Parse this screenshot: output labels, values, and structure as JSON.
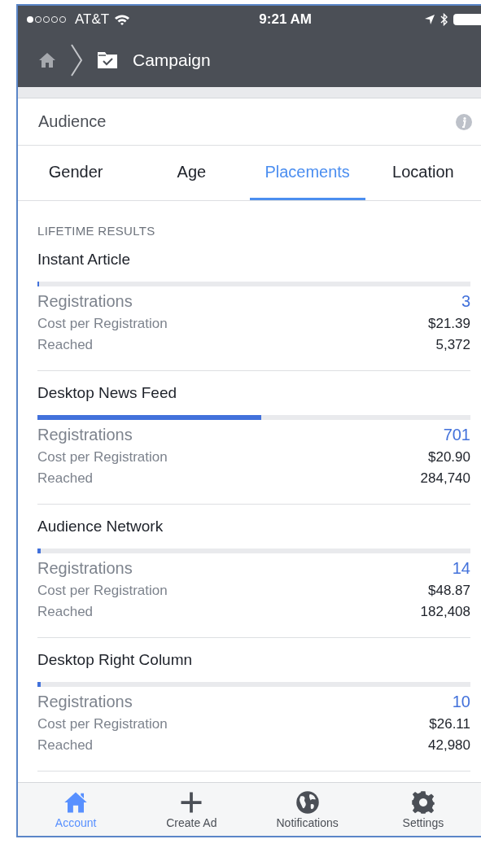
{
  "status_bar": {
    "carrier": "AT&T",
    "time": "9:21 AM"
  },
  "nav": {
    "title": "Campaign"
  },
  "section": {
    "title": "Audience"
  },
  "tabs": [
    {
      "label": "Gender",
      "selected": false
    },
    {
      "label": "Age",
      "selected": false
    },
    {
      "label": "Placements",
      "selected": true
    },
    {
      "label": "Location",
      "selected": false
    }
  ],
  "results": {
    "heading": "LIFETIME RESULTS",
    "placements": [
      {
        "name": "Instant Article",
        "level": 0.004,
        "metrics": [
          {
            "label": "Registrations",
            "value": "3",
            "kind": "primary"
          },
          {
            "label": "Cost per Registration",
            "value": "$21.39",
            "kind": "secondary"
          },
          {
            "label": "Reached",
            "value": "5,372",
            "kind": "secondary"
          }
        ]
      },
      {
        "name": "Desktop News Feed",
        "level": 0.517,
        "metrics": [
          {
            "label": "Registrations",
            "value": "701",
            "kind": "primary"
          },
          {
            "label": "Cost per Registration",
            "value": "$20.90",
            "kind": "secondary"
          },
          {
            "label": "Reached",
            "value": "284,740",
            "kind": "secondary"
          }
        ]
      },
      {
        "name": "Audience Network",
        "level": 0.008,
        "metrics": [
          {
            "label": "Registrations",
            "value": "14",
            "kind": "primary"
          },
          {
            "label": "Cost per Registration",
            "value": "$48.87",
            "kind": "secondary"
          },
          {
            "label": "Reached",
            "value": "182,408",
            "kind": "secondary"
          }
        ]
      },
      {
        "name": "Desktop Right Column",
        "level": 0.008,
        "metrics": [
          {
            "label": "Registrations",
            "value": "10",
            "kind": "primary"
          },
          {
            "label": "Cost per Registration",
            "value": "$26.11",
            "kind": "secondary"
          },
          {
            "label": "Reached",
            "value": "42,980",
            "kind": "secondary"
          }
        ]
      }
    ]
  },
  "tab_bar": [
    {
      "label": "Account",
      "selected": true
    },
    {
      "label": "Create Ad",
      "selected": false
    },
    {
      "label": "Notifications",
      "selected": false
    },
    {
      "label": "Settings",
      "selected": false
    }
  ]
}
